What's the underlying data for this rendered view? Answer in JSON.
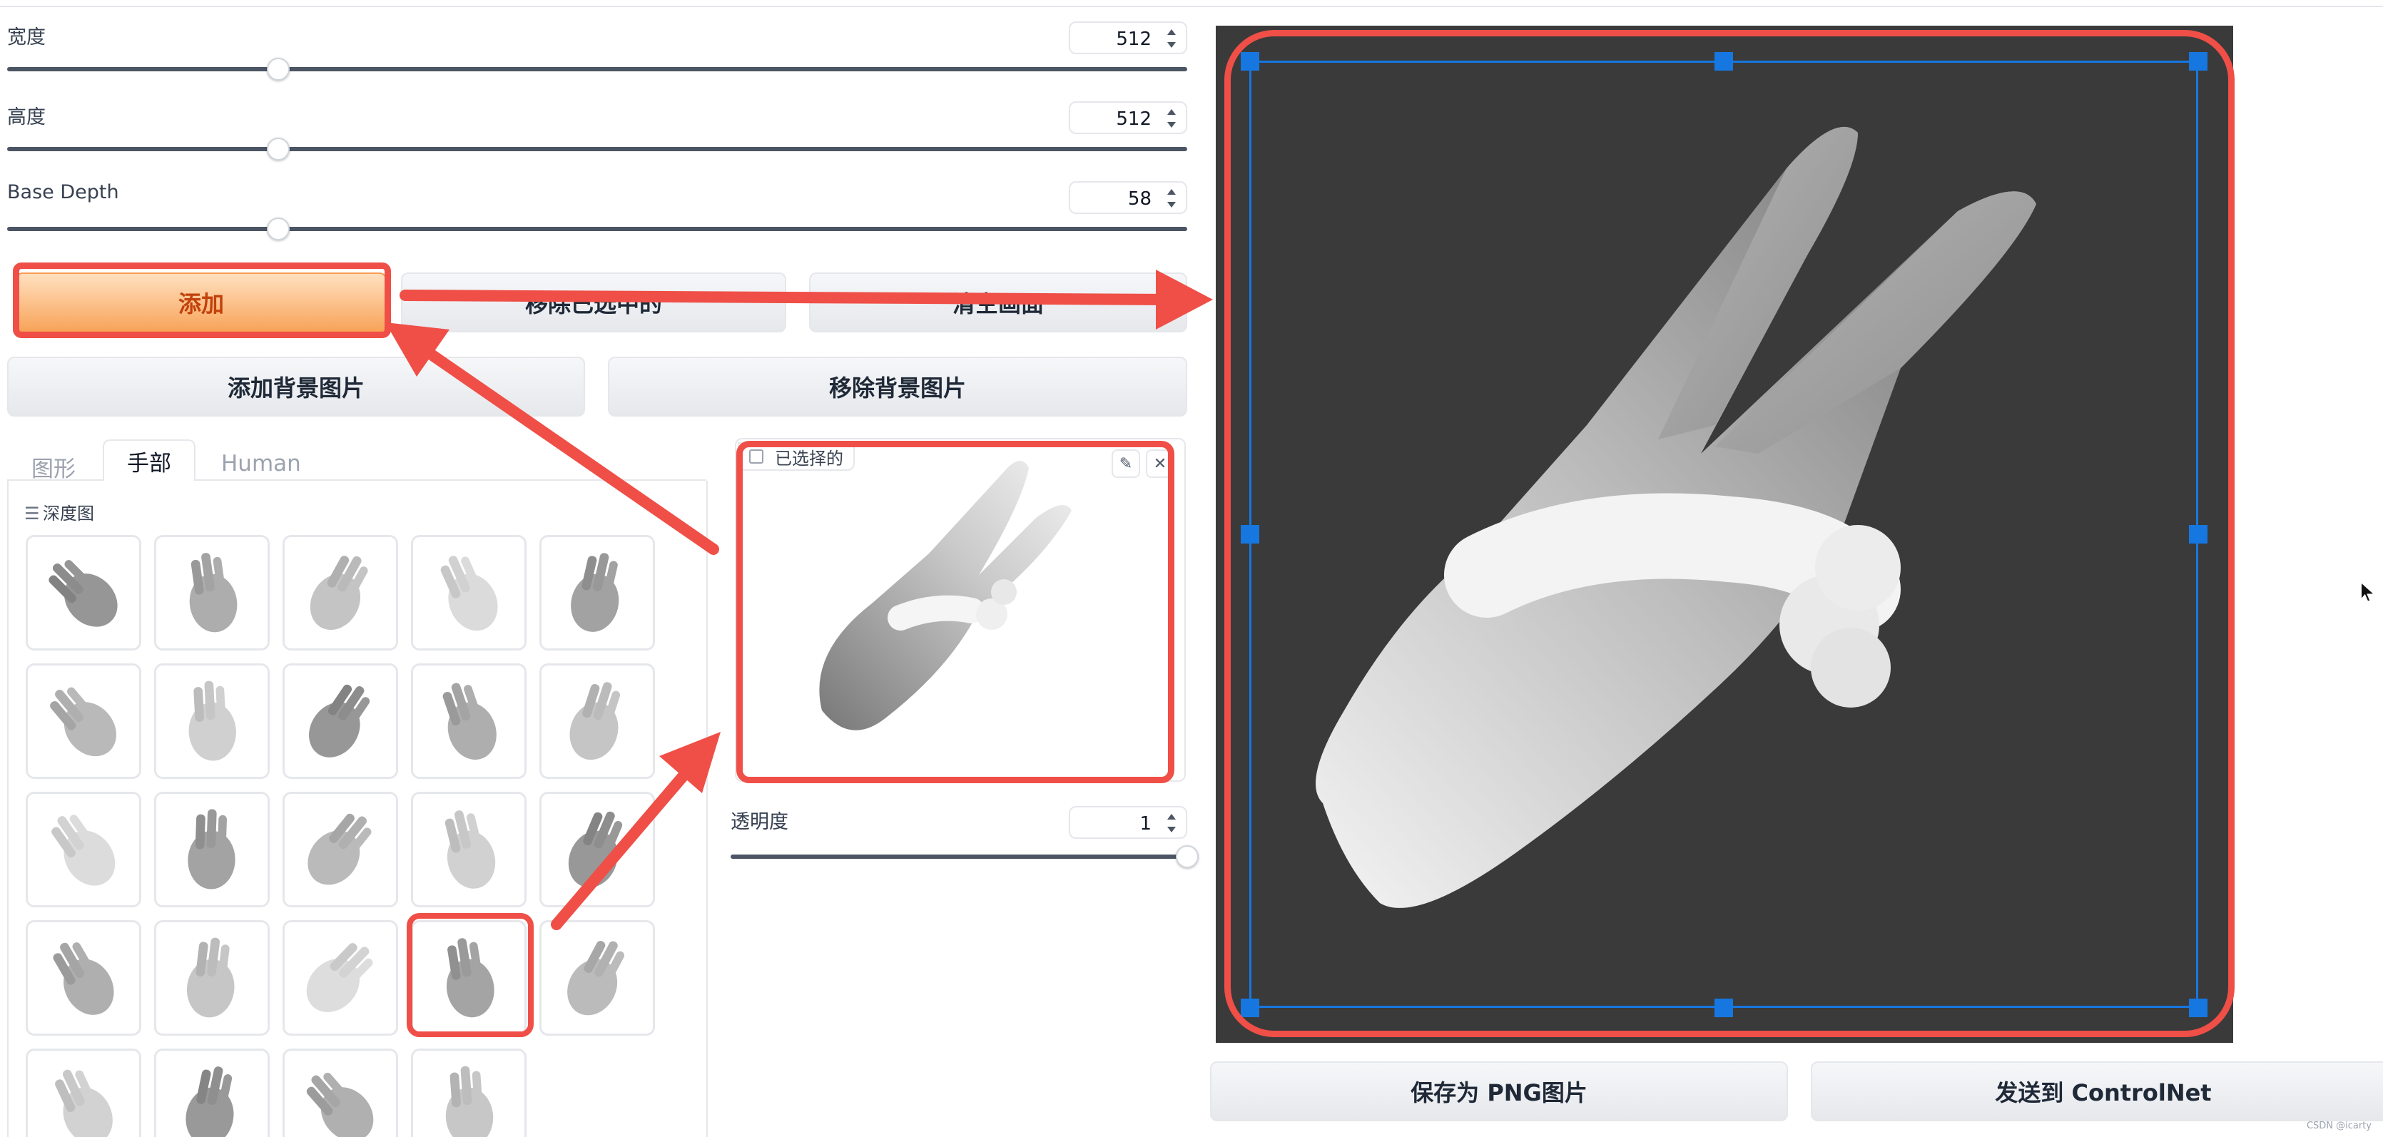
{
  "params": {
    "width": {
      "label": "宽度",
      "value": "512"
    },
    "height": {
      "label": "高度",
      "value": "512"
    },
    "base_depth": {
      "label": "Base Depth",
      "value": "58"
    }
  },
  "sliders": {
    "width_fraction": 0.23,
    "height_fraction": 0.23,
    "base_depth_fraction": 0.23,
    "opacity_fraction": 1.0
  },
  "actions": {
    "add": "添加",
    "remove_selected": "移除已选中的",
    "clear_canvas": "清空画面",
    "add_background": "添加背景图片",
    "remove_background": "移除背景图片"
  },
  "tabs": [
    "图形",
    "手部",
    "Human"
  ],
  "active_tab": "手部",
  "gallery": {
    "label": "深度图",
    "items": [
      "fist",
      "open-hand-side",
      "open-hand-front",
      "spread-hand",
      "fist-top",
      "two-finger",
      "knuckles",
      "rock-sign",
      "pointing",
      "horns",
      "bent-hand",
      "soft-fist",
      "curled",
      "three-finger",
      "cupped-thumb",
      "claw",
      "flat-fist",
      "pinch",
      "peace-sign",
      "v-sign",
      "bent-wrist",
      "point-up",
      "three-up",
      "flat-stack"
    ],
    "selected_index": 18
  },
  "selected_panel": {
    "label": "已选择的",
    "edit_icon": "pencil-icon",
    "close_icon": "close-icon"
  },
  "opacity": {
    "label": "透明度",
    "value": "1"
  },
  "footer": {
    "save_png": "保存为 PNG图片",
    "send_controlnet": "发送到 ControlNet"
  },
  "watermark": "CSDN @icarty",
  "colors": {
    "accent": "#f79b52",
    "highlight": "#ef4f47",
    "selection": "#1677e0",
    "canvas": "#3a3a3a"
  }
}
